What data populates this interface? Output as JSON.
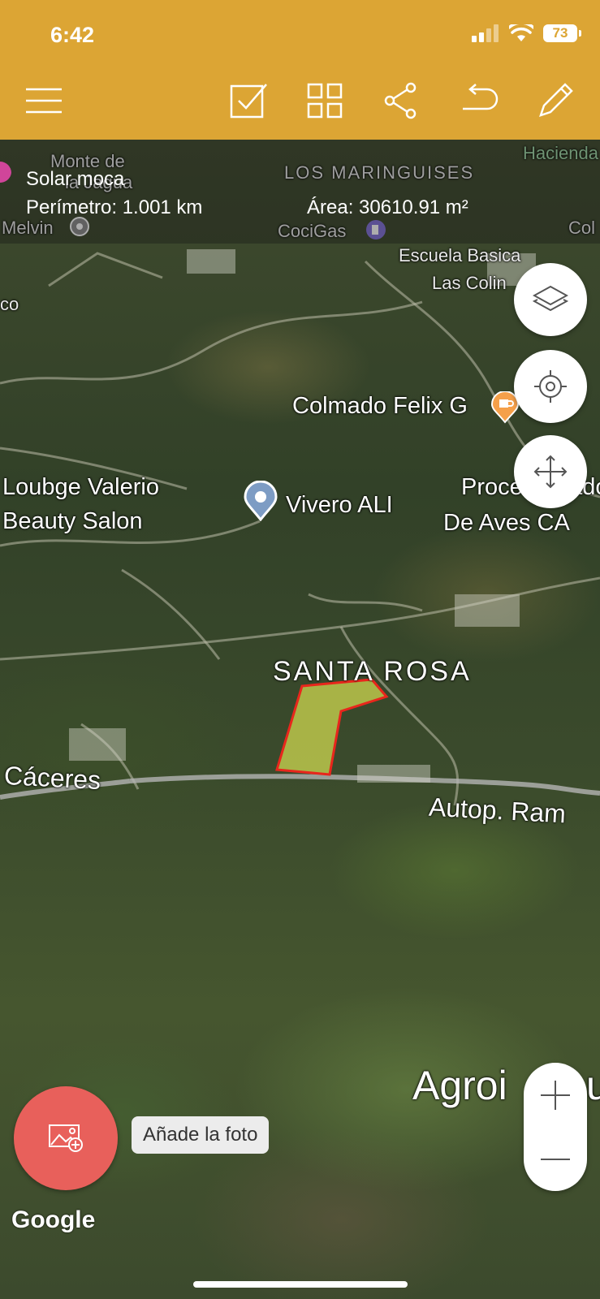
{
  "status": {
    "time": "6:42",
    "battery": "73"
  },
  "toolbar": {
    "icons": [
      "menu-icon",
      "checkbox-icon",
      "grid-icon",
      "share-icon",
      "undo-icon",
      "pencil-icon"
    ]
  },
  "info": {
    "name": "Solar moca",
    "perimeter": "Perímetro: 1.001 km",
    "area": "Área: 30610.91 m²"
  },
  "map_labels": {
    "monte_de": "Monte de",
    "la_jagua": "la Jagua",
    "los_maringuises": "LOS MARINGUISES",
    "hacienda": "Hacienda",
    "melvin": "Melvin",
    "cocigas": "CociGas",
    "col": "Col",
    "escuela_basica": "Escuela Basica",
    "las_colin": "Las Colin",
    "co": "co",
    "colmado_felix": "Colmado Felix G",
    "loubge_valerio": "Loubge Valerio",
    "beauty_salon": "Beauty Salon",
    "vivero_ali": "Vivero ALI",
    "proce": "Proce",
    "dado": "dado",
    "de_aves": "De Aves CA",
    "santa_rosa": "SANTA ROSA",
    "caceres": "Cáceres",
    "autop": "Autop. Ram",
    "agroi": "Agroi",
    "u": "u"
  },
  "photo": {
    "tooltip": "Añade la foto"
  },
  "attribution": "Google",
  "colors": {
    "toolbar": "#dca534",
    "polygon_fill": "#c8d04a",
    "polygon_stroke": "#e8261c",
    "photo_button": "#e8605b"
  }
}
